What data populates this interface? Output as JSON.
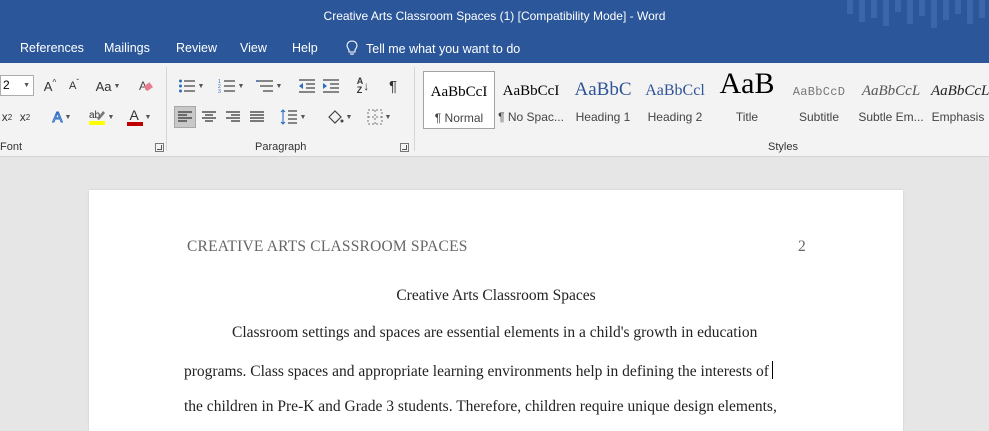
{
  "window": {
    "title": "Creative Arts Classroom Spaces (1) [Compatibility Mode]  -  Word"
  },
  "menu": {
    "tabs": [
      "References",
      "Mailings",
      "Review",
      "View",
      "Help"
    ],
    "tell_me": "Tell me what you want to do"
  },
  "ribbon": {
    "font_size_value": "2",
    "font_group_label": "Font",
    "paragraph_group_label": "Paragraph",
    "styles_group_label": "Styles",
    "grow_font": "A",
    "shrink_font": "A",
    "change_case": "Aa",
    "superscript": "x",
    "subscript": "x",
    "superscript_mark": "2",
    "subscript_mark": "2",
    "text_effects": "A",
    "font_color": "A",
    "sort": "A",
    "sort_bottom": "Z",
    "pilcrow": "¶",
    "font_color_swatch": "#c00000",
    "highlight_swatch": "#ffff00"
  },
  "styles": [
    {
      "sample": "AaBbCcI",
      "name": "¶ Normal",
      "selected": true
    },
    {
      "sample": "AaBbCcI",
      "name": "¶ No Spac..."
    },
    {
      "sample": "AaBbC",
      "name": "Heading 1"
    },
    {
      "sample": "AaBbCcl",
      "name": "Heading 2"
    },
    {
      "sample": "AaB",
      "name": "Title"
    },
    {
      "sample": "AaBbCcD",
      "name": "Subtitle"
    },
    {
      "sample": "AaBbCcL",
      "name": "Subtle Em..."
    },
    {
      "sample": "AaBbCcL",
      "name": "Emphasis"
    }
  ],
  "document": {
    "running_header": "CREATIVE ARTS CLASSROOM SPACES",
    "page_number": "2",
    "title": "Creative Arts Classroom Spaces",
    "lines": [
      "Classroom settings and spaces are essential elements in a child's growth in education",
      "programs. Class spaces and appropriate learning environments help in defining the interests of",
      "the children in Pre-K and Grade 3 students. Therefore, children require unique design elements,"
    ]
  },
  "colors": {
    "brand": "#2b579a",
    "ribbon_bg": "#f3f3f3",
    "canvas_bg": "#e6e6e6"
  }
}
